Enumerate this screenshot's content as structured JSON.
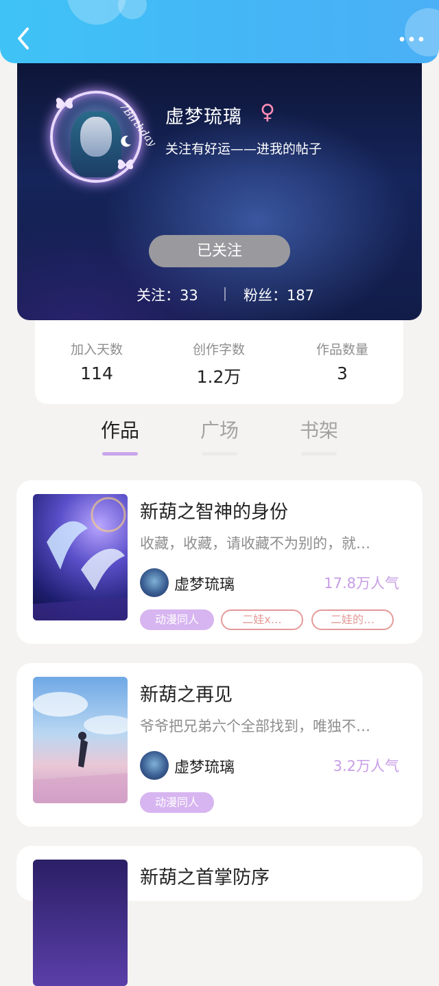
{
  "topbar": {
    "back_icon": "back-chevron-icon",
    "more_icon": "more-dots-icon"
  },
  "profile": {
    "avatar_caption": "7Birthday",
    "name": "虚梦琉璃",
    "gender_symbol": "♀",
    "bio": "关注有好运——进我的帖子",
    "follow_button": "已关注",
    "following": "关注：33",
    "followers": "粉丝：187"
  },
  "stats": [
    {
      "label": "加入天数",
      "value": "114"
    },
    {
      "label": "创作字数",
      "value": "1.2万"
    },
    {
      "label": "作品数量",
      "value": "3"
    }
  ],
  "tabs": [
    {
      "label": "作品",
      "active": true
    },
    {
      "label": "广场",
      "active": false
    },
    {
      "label": "书架",
      "active": false
    }
  ],
  "colors": {
    "accent": "#c79de6",
    "tag_fill": "#d7b5f0",
    "tag_outline": "#e39a98"
  },
  "works": [
    {
      "title": "新葫之智神的身份",
      "desc": "收藏，收藏，请收藏不为别的，就…",
      "author": "虚梦琉璃",
      "popularity": "17.8万人气",
      "tags": [
        "动漫同人",
        "二娃x…",
        "二娃的…"
      ]
    },
    {
      "title": "新葫之再见",
      "desc": "爷爷把兄弟六个全部找到，唯独不…",
      "author": "虚梦琉璃",
      "popularity": "3.2万人气",
      "tags": [
        "动漫同人"
      ]
    },
    {
      "title": "新葫之首掌防序"
    }
  ]
}
